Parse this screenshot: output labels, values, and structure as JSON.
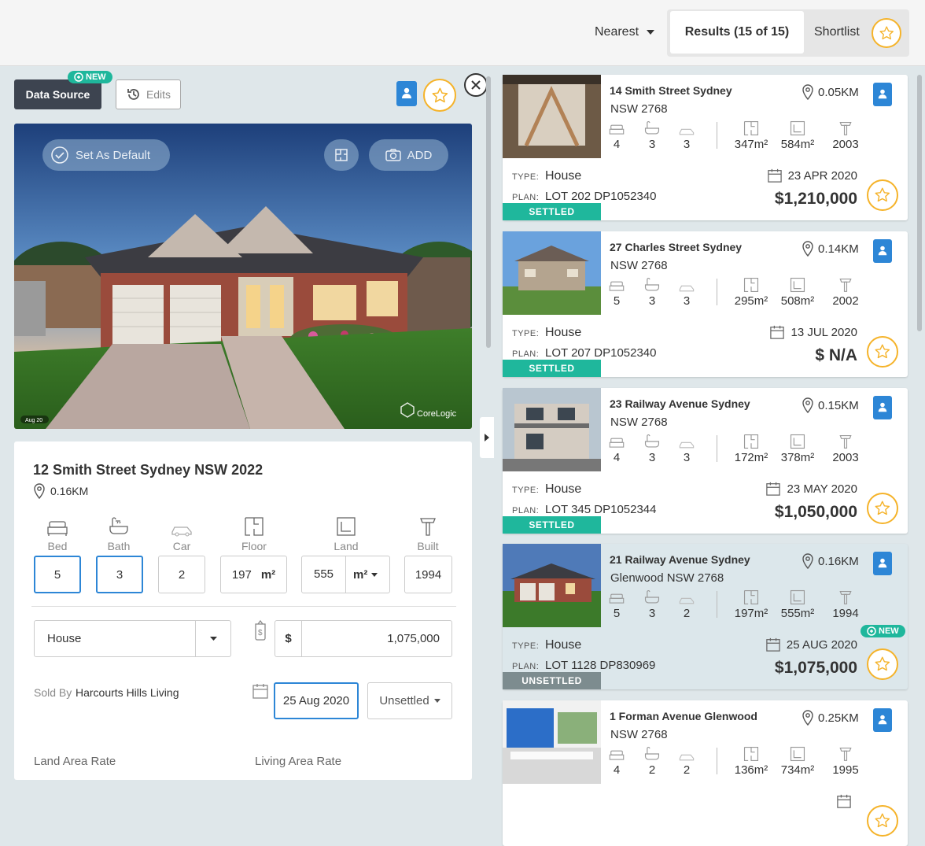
{
  "header": {
    "sort_label": "Nearest",
    "tab_results": "Results (15 of 15)",
    "tab_shortlist": "Shortlist"
  },
  "panel": {
    "data_source_label": "Data Source",
    "new_badge": "NEW",
    "edits_label": "Edits",
    "photo": {
      "set_default_label": "Set As Default",
      "add_label": "ADD",
      "watermark": "CoreLogic",
      "photo_date": "Aug 20"
    },
    "address": "12 Smith Street Sydney NSW 2022",
    "distance": "0.16KM",
    "features": {
      "bed_label": "Bed",
      "bed_value": "5",
      "bath_label": "Bath",
      "bath_value": "3",
      "car_label": "Car",
      "car_value": "2",
      "floor_label": "Floor",
      "floor_value": "197",
      "floor_unit": "m²",
      "land_label": "Land",
      "land_value": "555",
      "land_unit": "m²",
      "built_label": "Built",
      "built_value": "1994"
    },
    "property_type": "House",
    "price_currency": "$",
    "price_value": "1,075,000",
    "sold_by_label": "Sold By",
    "sold_by_value": "Harcourts Hills Living",
    "sale_date": "25 Aug 2020",
    "sale_status": "Unsettled",
    "land_rate_label": "Land Area Rate",
    "living_rate_label": "Living Area Rate"
  },
  "results": [
    {
      "addr1": "14 Smith Street Sydney",
      "addr2": "NSW 2768",
      "distance": "0.05KM",
      "status": "SETTLED",
      "bed": "4",
      "bath": "3",
      "car": "3",
      "floor": "347m²",
      "land": "584m²",
      "built": "2003",
      "type_key": "TYPE:",
      "type": "House",
      "plan_key": "PLAN:",
      "plan": "LOT 202 DP1052340",
      "date": "23 APR 2020",
      "price": "$1,210,000"
    },
    {
      "addr1": "27 Charles Street Sydney",
      "addr2": "NSW 2768",
      "distance": "0.14KM",
      "status": "SETTLED",
      "bed": "5",
      "bath": "3",
      "car": "3",
      "floor": "295m²",
      "land": "508m²",
      "built": "2002",
      "type_key": "TYPE:",
      "type": "House",
      "plan_key": "PLAN:",
      "plan": "LOT 207 DP1052340",
      "date": "13 JUL 2020",
      "price": "$ N/A"
    },
    {
      "addr1": "23 Railway Avenue Sydney",
      "addr2": "NSW 2768",
      "distance": "0.15KM",
      "status": "SETTLED",
      "bed": "4",
      "bath": "3",
      "car": "3",
      "floor": "172m²",
      "land": "378m²",
      "built": "2003",
      "type_key": "TYPE:",
      "type": "House",
      "plan_key": "PLAN:",
      "plan": "LOT 345 DP1052344",
      "date": "23 MAY 2020",
      "price": "$1,050,000"
    },
    {
      "addr1": "21 Railway Avenue Sydney",
      "addr2": "Glenwood NSW 2768",
      "distance": "0.16KM",
      "status": "UNSETTLED",
      "bed": "5",
      "bath": "3",
      "car": "2",
      "floor": "197m²",
      "land": "555m²",
      "built": "1994",
      "type_key": "TYPE:",
      "type": "House",
      "plan_key": "PLAN:",
      "plan": "LOT 1128 DP830969",
      "date": "25 AUG 2020",
      "price": "$1,075,000",
      "new_badge": "NEW"
    },
    {
      "addr1": "1 Forman Avenue Glenwood",
      "addr2": "NSW 2768",
      "distance": "0.25KM",
      "status": "",
      "bed": "4",
      "bath": "2",
      "car": "2",
      "floor": "136m²",
      "land": "734m²",
      "built": "1995"
    }
  ],
  "colors": {
    "accent_blue": "#2d86d6",
    "star_gold": "#f5b32a",
    "settled": "#1fb79c",
    "unsettled": "#7d8c8f",
    "new_badge": "#1fb79c",
    "dark_button": "#3d4450"
  }
}
